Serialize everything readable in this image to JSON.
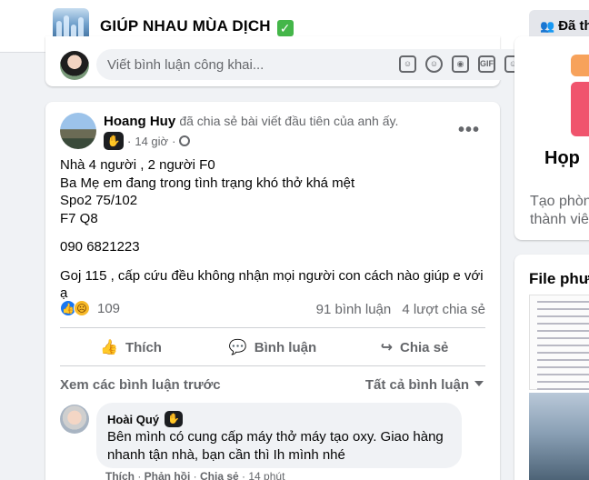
{
  "header": {
    "group_name": "GIÚP NHAU MÙA DỊCH",
    "verified_emoji": "✓",
    "joined_label": "Đã th"
  },
  "prev_card": {
    "comment_placeholder": "Viết bình luận công khai..."
  },
  "post": {
    "author": "Hoang Huy",
    "action_text": "đã chia sẻ bài viết đầu tiên của anh ấy.",
    "time": "14 giờ",
    "dot": "·",
    "more": "•••",
    "body": [
      "Nhà 4 người , 2 người F0",
      "Ba Mẹ em đang trong tình trạng khó thở khá mệt",
      "Spo2 75/102",
      "F7 Q8",
      "090 6821223",
      "Goj 115 , cấp cứu đều không nhận mọi người con cách nào giúp e với ạ"
    ],
    "reaction_count": "109",
    "comments_count": "91 bình luận",
    "shares_count": "4 lượt chia sẻ",
    "actions": {
      "like": "Thích",
      "comment": "Bình luận",
      "share": "Chia sẻ"
    },
    "view_previous": "Xem các bình luận trước",
    "comment_filter": "Tất cả bình luận"
  },
  "comment": {
    "author": "Hoài Quý",
    "text": "Bên mình có cung cấp máy thở máy tạo oxy. Giao hàng nhanh tận nhà, bạn cần thì Ih mình nhé",
    "like": "Thích",
    "reply": "Phản hồi",
    "share": "Chia sẻ",
    "time": "14 phút"
  },
  "right": {
    "card_title": "Họp",
    "card_text_1": "Tạo phòn",
    "card_text_2": "thành viê",
    "files_title": "File phươ"
  },
  "icons": {
    "group_thumb": "group-cover-image",
    "joined": "people-icon",
    "wave": "wave-hand-icon",
    "globe": "globe-icon",
    "like_reaction": "like-reaction-icon",
    "sad_reaction": "sad-reaction-icon"
  },
  "colors": {
    "accent": "#1877f2",
    "secondary_text": "#65676b",
    "background": "#f0f2f5",
    "verified": "#44b649"
  }
}
